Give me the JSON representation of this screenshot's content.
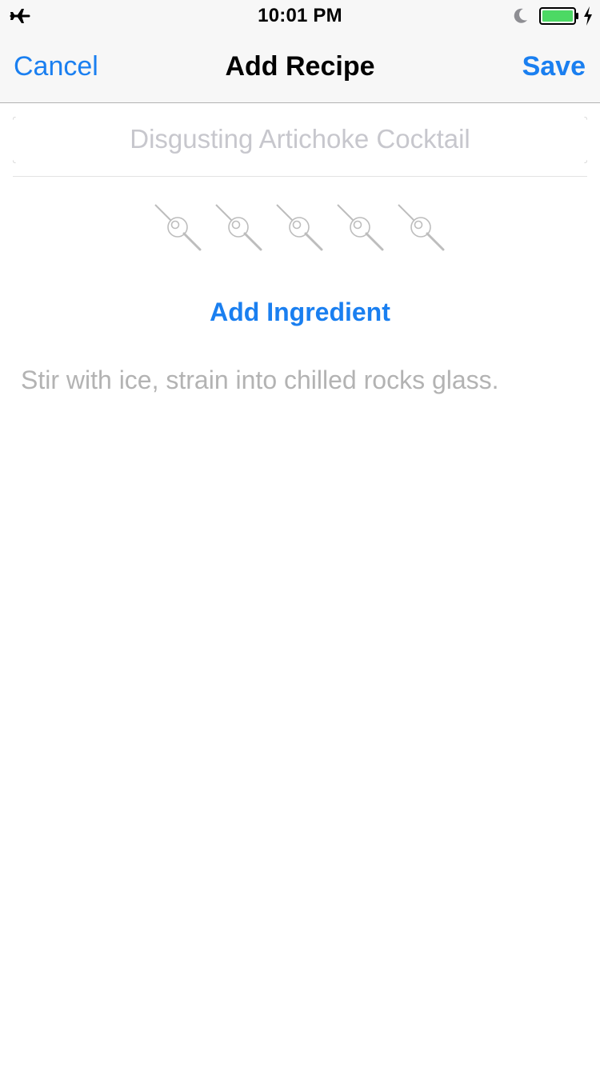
{
  "status_bar": {
    "time": "10:01 PM",
    "icons": [
      "airplane-icon",
      "moon-icon",
      "battery-icon",
      "charge-icon"
    ],
    "battery_color": "#4cd964"
  },
  "nav": {
    "cancel_label": "Cancel",
    "title": "Add Recipe",
    "save_label": "Save",
    "tint_color": "#1a7ff0"
  },
  "recipe": {
    "name_value": "",
    "name_placeholder": "Disgusting Artichoke Cocktail",
    "rating": {
      "value": 0,
      "max": 5,
      "icon": "cocktail-pick-olive-icon"
    },
    "add_ingredient_label": "Add Ingredient",
    "instructions_placeholder": "Stir with ice, strain into chilled rocks glass."
  }
}
